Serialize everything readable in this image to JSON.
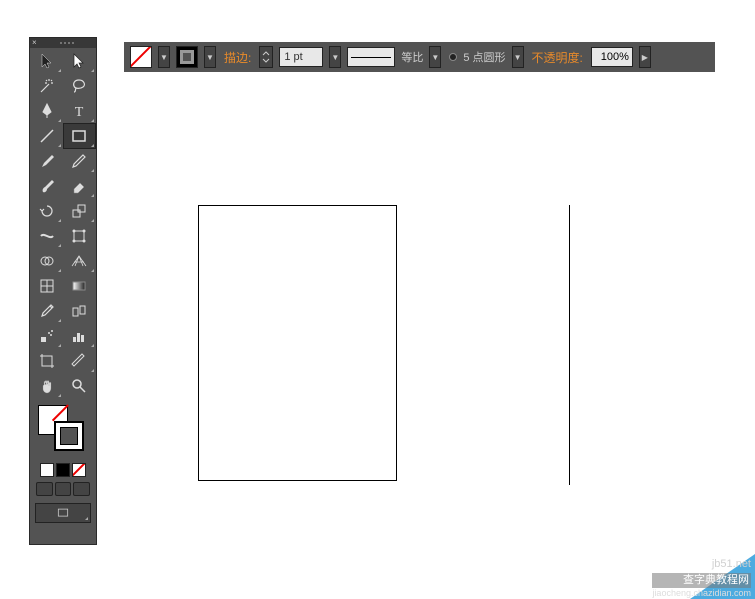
{
  "topbar": {
    "stroke_label": "描边:",
    "stroke_value": "1 pt",
    "stroke_type": "等比",
    "profile": "5 点圆形",
    "opacity_label": "不透明度:",
    "opacity_value": "100%"
  },
  "tools": [
    {
      "name": "selection-tool",
      "icon": "arrow"
    },
    {
      "name": "direct-selection-tool",
      "icon": "arrow-white"
    },
    {
      "name": "magic-wand-tool",
      "icon": "wand"
    },
    {
      "name": "lasso-tool",
      "icon": "lasso"
    },
    {
      "name": "pen-tool",
      "icon": "pen"
    },
    {
      "name": "type-tool",
      "icon": "type"
    },
    {
      "name": "line-tool",
      "icon": "line"
    },
    {
      "name": "rectangle-tool",
      "icon": "rect",
      "selected": true
    },
    {
      "name": "paintbrush-tool",
      "icon": "brush"
    },
    {
      "name": "pencil-tool",
      "icon": "pencil"
    },
    {
      "name": "blob-brush-tool",
      "icon": "blob"
    },
    {
      "name": "eraser-tool",
      "icon": "eraser"
    },
    {
      "name": "rotate-tool",
      "icon": "rotate"
    },
    {
      "name": "scale-tool",
      "icon": "scale"
    },
    {
      "name": "width-tool",
      "icon": "width"
    },
    {
      "name": "free-transform-tool",
      "icon": "transform"
    },
    {
      "name": "shape-builder-tool",
      "icon": "shapebuild"
    },
    {
      "name": "perspective-grid-tool",
      "icon": "perspective"
    },
    {
      "name": "mesh-tool",
      "icon": "mesh"
    },
    {
      "name": "gradient-tool",
      "icon": "gradient"
    },
    {
      "name": "eyedropper-tool",
      "icon": "eyedrop"
    },
    {
      "name": "blend-tool",
      "icon": "blend"
    },
    {
      "name": "symbol-sprayer-tool",
      "icon": "spray"
    },
    {
      "name": "column-graph-tool",
      "icon": "graph"
    },
    {
      "name": "artboard-tool",
      "icon": "artboard"
    },
    {
      "name": "slice-tool",
      "icon": "slice"
    },
    {
      "name": "hand-tool",
      "icon": "hand"
    },
    {
      "name": "zoom-tool",
      "icon": "zoom"
    }
  ],
  "watermark": {
    "line1": "jb51.net",
    "line2": "查字典教程网",
    "line3": "jiaocheng.chazidian.com"
  },
  "colors": {
    "label": "#e88a2a",
    "panel": "#535353"
  }
}
